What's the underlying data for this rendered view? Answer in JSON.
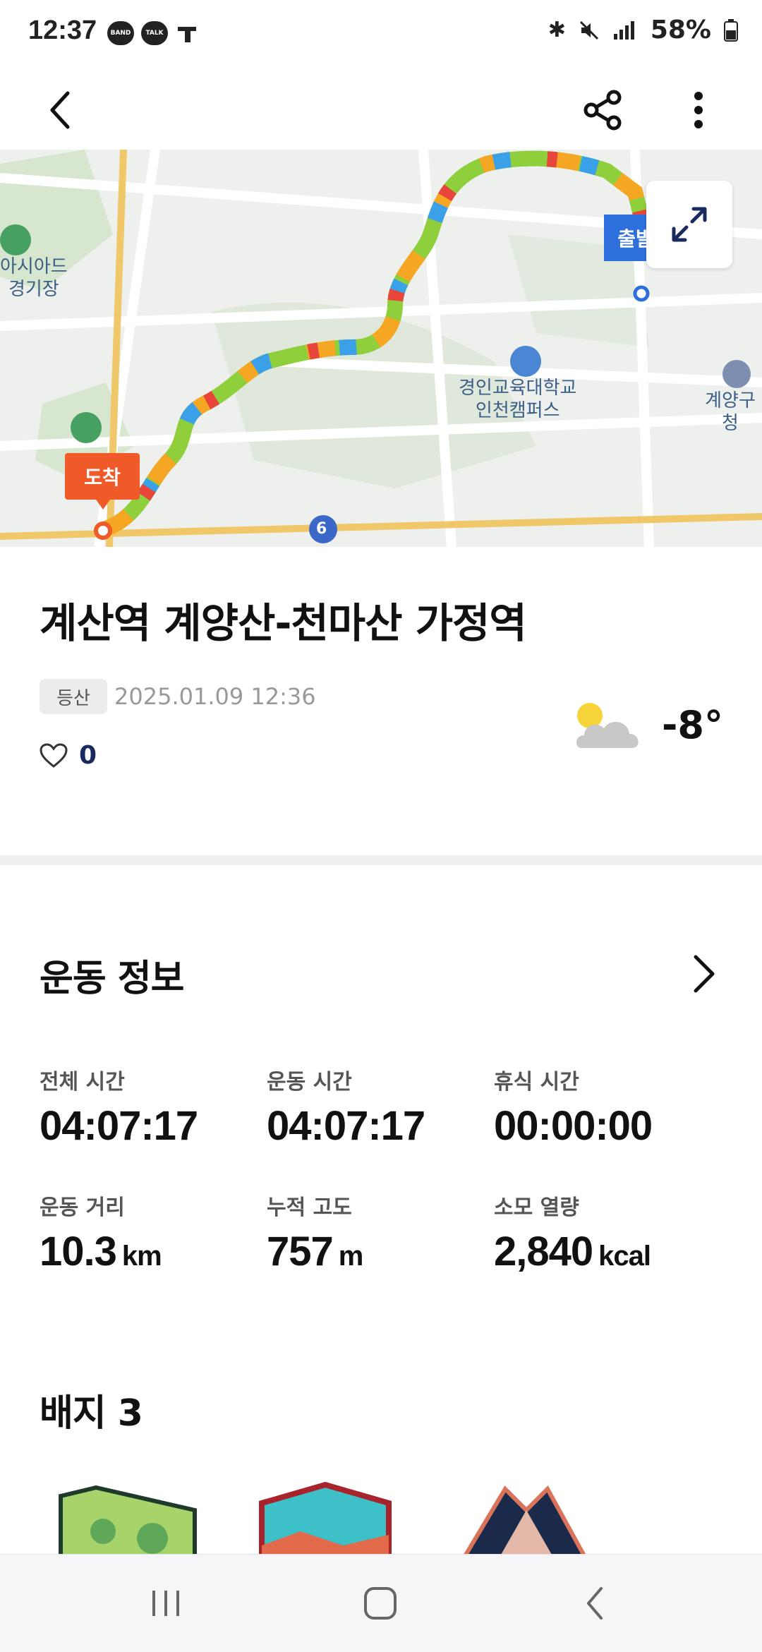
{
  "status": {
    "time": "12:37",
    "badges": [
      "BAND",
      "TALK"
    ],
    "battery": "58%"
  },
  "icons": {
    "back": "back-arrow-icon",
    "share": "share-icon",
    "more": "more-vertical-icon",
    "expand": "expand-icon",
    "like": "heart-icon",
    "weather": "partly-cloudy-icon",
    "detail": "chevron-right-icon"
  },
  "map": {
    "start_label": "출발",
    "end_label": "도착",
    "places": [
      {
        "name": "아시아드\n경기장"
      },
      {
        "name": "경인교육대학교\n인천캠퍼스"
      },
      {
        "name": "계양구청"
      },
      {
        "name": "6"
      }
    ]
  },
  "activity": {
    "title": "계산역 계양산-천마산 가정역",
    "category": "등산",
    "datetime": "2025.01.09 12:36",
    "likes": "0",
    "temperature": "-8°"
  },
  "exercise": {
    "section_title": "운동 정보",
    "stats": [
      {
        "label": "전체 시간",
        "value": "04:07:17",
        "unit": ""
      },
      {
        "label": "운동 시간",
        "value": "04:07:17",
        "unit": ""
      },
      {
        "label": "휴식 시간",
        "value": "00:00:00",
        "unit": ""
      },
      {
        "label": "운동 거리",
        "value": "10.3",
        "unit": "km"
      },
      {
        "label": "누적 고도",
        "value": "757",
        "unit": "m"
      },
      {
        "label": "소모 열량",
        "value": "2,840",
        "unit": "kcal"
      }
    ]
  },
  "badges": {
    "section_title": "배지 3"
  },
  "colors": {
    "start_pin": "#2d6fdc",
    "end_pin": "#f05a28",
    "like_count": "#1b2a5e"
  }
}
